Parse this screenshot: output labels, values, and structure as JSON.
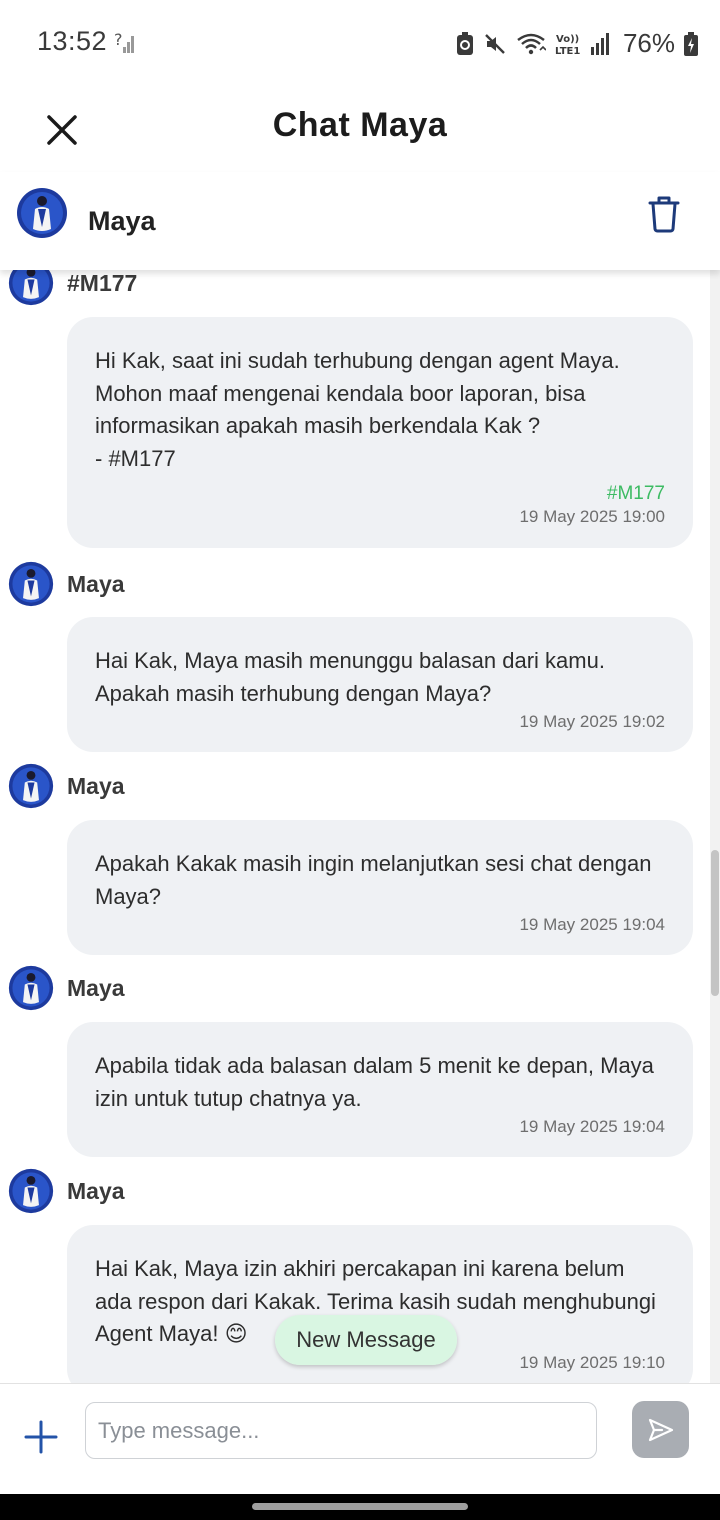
{
  "status_bar": {
    "time": "13:52",
    "battery": "76%"
  },
  "header": {
    "title": "Chat Maya"
  },
  "agent": {
    "name": "Maya"
  },
  "messages": [
    {
      "sender": "#M177",
      "text": "Hi Kak, saat ini sudah terhubung dengan agent Maya.\nMohon maaf mengenai kendala boor laporan, bisa informasikan apakah masih berkendala Kak ?\n- #M177",
      "tag": "#M177",
      "time": "19 May 2025 19:00"
    },
    {
      "sender": "Maya",
      "text": "Hai Kak, Maya masih menunggu balasan dari kamu. Apakah masih terhubung dengan Maya?",
      "time": "19 May 2025 19:02"
    },
    {
      "sender": "Maya",
      "text": "Apakah Kakak masih ingin melanjutkan sesi chat dengan Maya?",
      "time": "19 May 2025 19:04"
    },
    {
      "sender": "Maya",
      "text": "Apabila tidak ada balasan dalam 5 menit ke depan, Maya izin untuk tutup chatnya ya.",
      "time": "19 May 2025 19:04"
    },
    {
      "sender": "Maya",
      "text": "Hai Kak, Maya izin akhiri percakapan ini karena belum ada respon dari Kakak. Terima kasih sudah menghubungi Agent Maya! 😊",
      "time": "19 May 2025 19:10"
    }
  ],
  "new_message_label": "New Message",
  "composer": {
    "placeholder": "Type message..."
  },
  "colors": {
    "bubble_bg": "#eff1f4",
    "tag_green": "#3dbb63",
    "avatar_blue": "#1d3a9e",
    "send_disabled": "#a9adb3",
    "accent_blue": "#2353a8"
  },
  "icons": [
    "close-icon",
    "trash-icon",
    "plus-icon",
    "send-icon",
    "agent-avatar-icon"
  ]
}
